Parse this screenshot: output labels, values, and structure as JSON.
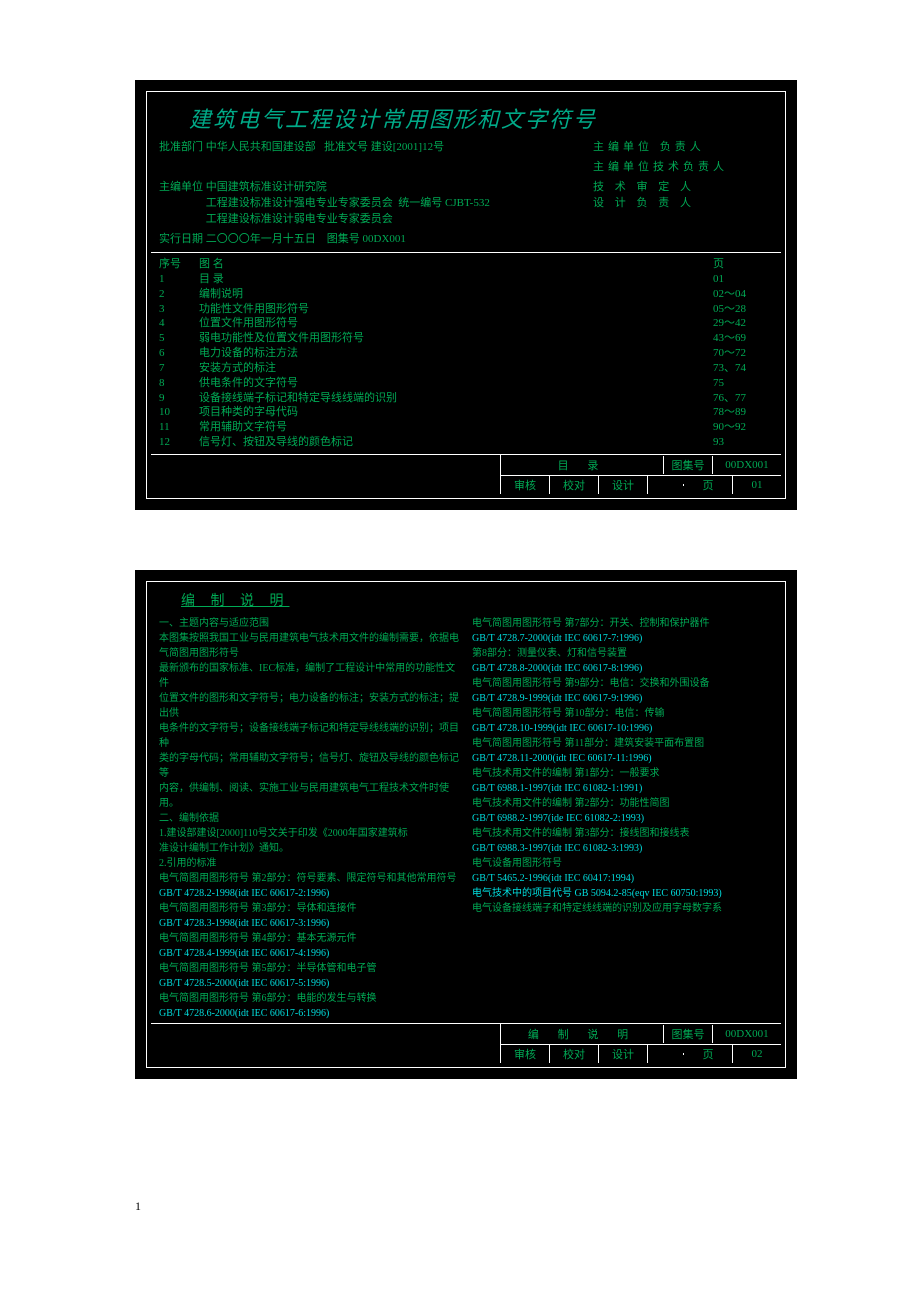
{
  "box1": {
    "main_title": "建筑电气工程设计常用图形和文字符号",
    "h1_left": "批准部门 中华人民共和国建设部",
    "h1_mid": "批准文号 建设[2001]12号",
    "h1_r1": "主编单位   负责人",
    "h1_r2": "主编单位技术负责人",
    "h2_left": "主编单位",
    "h2_org1": "中国建筑标准设计研究院",
    "h2_org2": "工程建设标准设计强电专业专家委员会",
    "h2_org3": "工程建设标准设计弱电专业专家委员会",
    "h2_mid": "统一编号 CJBT-532",
    "h2_r1": "技 术 审 定 人",
    "h2_r2": "设 计 负 责 人",
    "h3_left": "实行日期 二〇〇〇年一月十五日",
    "h3_mid": "图集号    00DX001",
    "toc_header": {
      "num": "序号",
      "name": "图             名",
      "page": "页"
    },
    "toc": [
      {
        "n": "1",
        "name": "目     录",
        "p": "01"
      },
      {
        "n": "2",
        "name": "编制说明",
        "p": "02～04"
      },
      {
        "n": "3",
        "name": "功能性文件用图形符号",
        "p": "05～28"
      },
      {
        "n": "4",
        "name": "位置文件用图形符号",
        "p": "29～42"
      },
      {
        "n": "5",
        "name": "弱电功能性及位置文件用图形符号",
        "p": "43～69"
      },
      {
        "n": "6",
        "name": "电力设备的标注方法",
        "p": "70～72"
      },
      {
        "n": "7",
        "name": "安装方式的标注",
        "p": "73、74"
      },
      {
        "n": "8",
        "name": "供电条件的文字符号",
        "p": "75"
      },
      {
        "n": "9",
        "name": "设备接线端子标记和特定导线线端的识别",
        "p": "76、77"
      },
      {
        "n": "10",
        "name": "项目种类的字母代码",
        "p": "78～89"
      },
      {
        "n": "11",
        "name": "常用辅助文字符号",
        "p": "90～92"
      },
      {
        "n": "12",
        "name": "信号灯、按钮及导线的颜色标记",
        "p": "93"
      }
    ],
    "footer": {
      "section_title": "目    录",
      "atlas_label": "图集号",
      "atlas_num": "00DX001",
      "c1": "审核",
      "c2": "校对",
      "c3": "设计",
      "page_label": "页",
      "page_num": "01"
    }
  },
  "box2": {
    "title": "编 制 说 明",
    "left": [
      "一、主题内容与适应范围",
      "    本图集按照我国工业与民用建筑电气技术用文件的编制需要，依据电气简图用图形符号",
      "最新颁布的国家标准、IEC标准，编制了工程设计中常用的功能性文件",
      "位置文件的图形和文字符号；电力设备的标注；安装方式的标注；提出供",
      "电条件的文字符号；设备接线端子标记和特定导线线端的识别；项目种",
      "类的字母代码；常用辅助文字符号；信号灯、旋钮及导线的颜色标记等",
      "内容，供编制、阅读、实施工业与民用建筑电气工程技术文件时使用。",
      "二、编制依据",
      "1.建设部建设[2000]110号文关于印发《2000年国家建筑标",
      "准设计编制工作计划》通知。",
      "2.引用的标准",
      "电气简图用图形符号    第2部分：符号要素、限定符号和其他常用符号",
      "GB/T 4728.2-1998(idt IEC 60617-2:1996)",
      "电气简图用图形符号    第3部分：导体和连接件",
      "GB/T 4728.3-1998(idt IEC 60617-3:1996)",
      "电气简图用图形符号    第4部分：基本无源元件",
      "GB/T 4728.4-1999(idt IEC 60617-4:1996)",
      "电气简图用图形符号    第5部分：半导体管和电子管",
      "GB/T 4728.5-2000(idt IEC 60617-5:1996)",
      "电气简图用图形符号    第6部分：电能的发生与转换",
      "GB/T 4728.6-2000(idt IEC 60617-6:1996)"
    ],
    "right": [
      "电气简图用图形符号    第7部分：开关、控制和保护器件",
      "GB/T 4728.7-2000(idt IEC 60617-7:1996)",
      "    第8部分：测量仪表、灯和信号装置",
      "GB/T 4728.8-2000(idt IEC 60617-8:1996)",
      "电气简图用图形符号    第9部分：电信：交换和外围设备",
      "GB/T 4728.9-1999(idt IEC 60617-9:1996)",
      "电气简图用图形符号    第10部分：电信：传输",
      "GB/T 4728.10-1999(idt IEC 60617-10:1996)",
      "电气简图用图形符号    第11部分：建筑安装平面布置图",
      "GB/T 4728.11-2000(idt IEC 60617-11:1996)",
      "电气技术用文件的编制    第1部分：一般要求",
      "GB/T 6988.1-1997(idt IEC 61082-1:1991)",
      "电气技术用文件的编制    第2部分：功能性简图",
      "GB/T 6988.2-1997(ide IEC 61082-2:1993)",
      "电气技术用文件的编制    第3部分：接线图和接线表",
      "GB/T 6988.3-1997(idt IEC 61082-3:1993)",
      "电气设备用图形符号",
      "GB/T 5465.2-1996(idt IEC 60417:1994)",
      "电气技术中的项目代号 GB 5094.2-85(eqv IEC 60750:1993)",
      "电气设备接线端子和特定线线端的识别及应用字母数字系"
    ],
    "cyan_idx_left": [
      12,
      14,
      16,
      18,
      20
    ],
    "cyan_idx_right": [
      1,
      3,
      5,
      7,
      9,
      11,
      13,
      15,
      17,
      18
    ],
    "footer": {
      "section_title": "编 制 说 明",
      "atlas_label": "图集号",
      "atlas_num": "00DX001",
      "c1": "审核",
      "c2": "校对",
      "c3": "设计",
      "page_label": "页",
      "page_num": "02"
    }
  },
  "page_number": "1"
}
